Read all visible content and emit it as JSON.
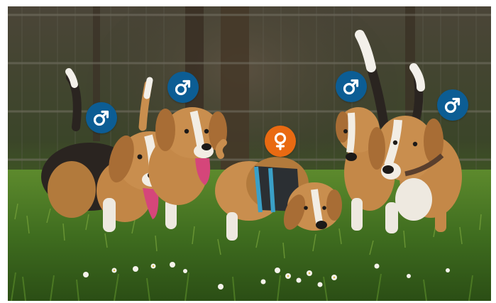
{
  "photo": {
    "subject": "beagle-group",
    "dog_count": 5
  },
  "markers": [
    {
      "id": "dog-1",
      "gender": "male",
      "icon": "male-symbol-icon",
      "color": "#0c5d94"
    },
    {
      "id": "dog-2",
      "gender": "male",
      "icon": "male-symbol-icon",
      "color": "#0c5d94"
    },
    {
      "id": "dog-3",
      "gender": "female",
      "icon": "female-symbol-icon",
      "color": "#e96a12"
    },
    {
      "id": "dog-4",
      "gender": "male",
      "icon": "male-symbol-icon",
      "color": "#0c5d94"
    },
    {
      "id": "dog-5",
      "gender": "male",
      "icon": "male-symbol-icon",
      "color": "#0c5d94"
    }
  ],
  "colors": {
    "male": "#0c5d94",
    "female": "#e96a12",
    "symbol": "#ffffff"
  }
}
